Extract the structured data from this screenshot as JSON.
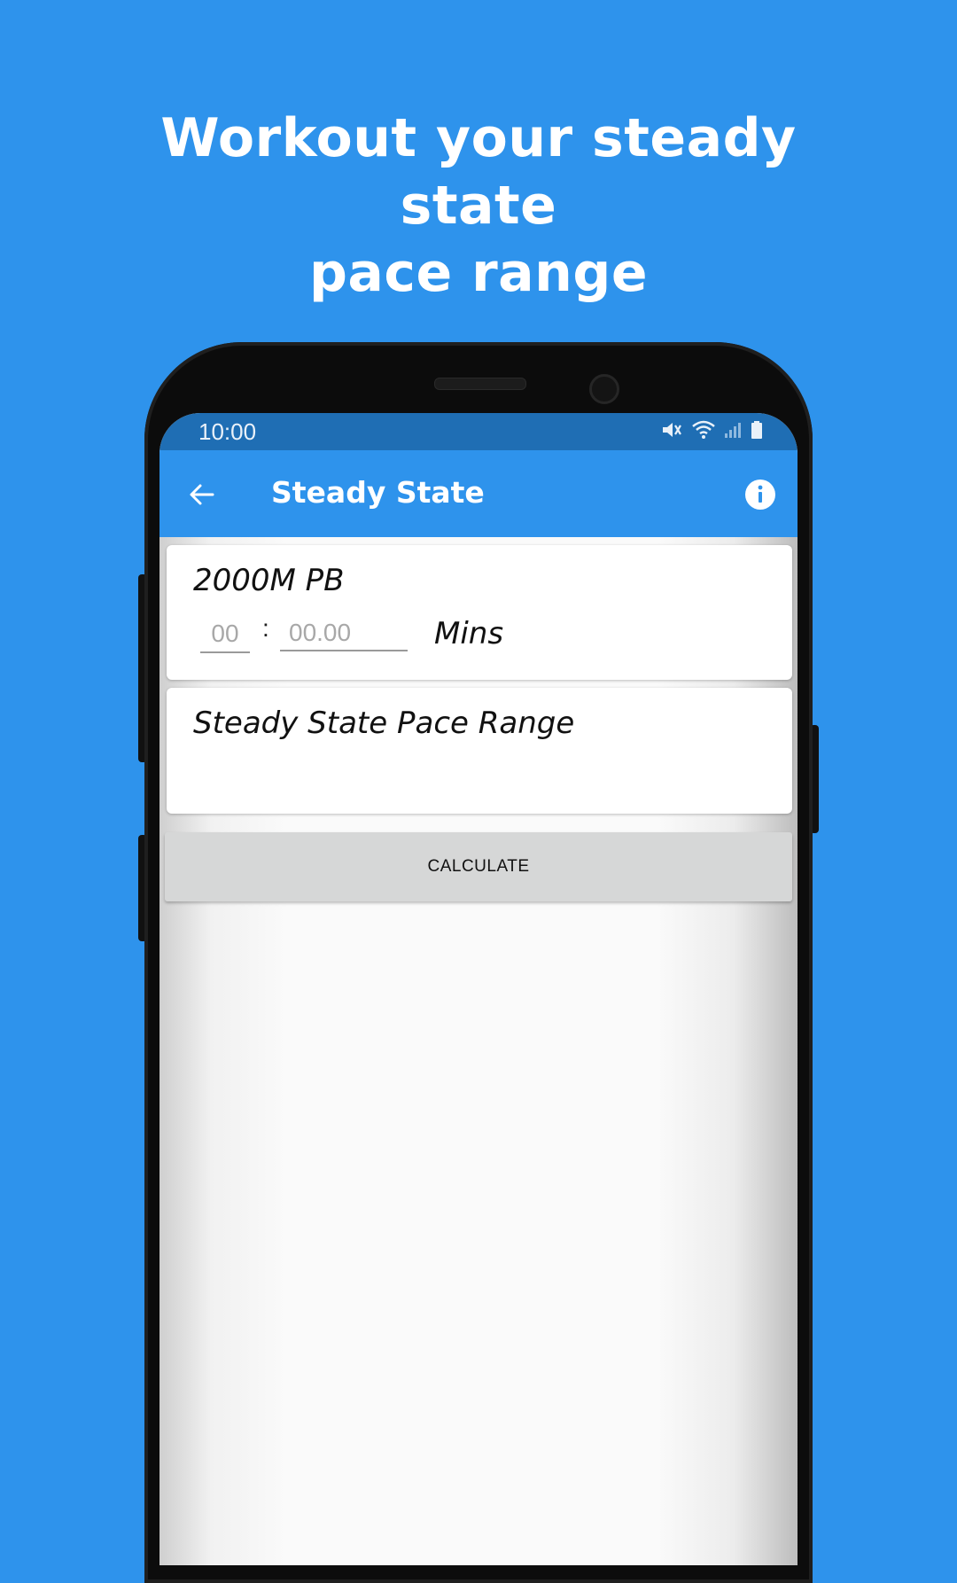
{
  "headline": {
    "line1": "Workout your steady state",
    "line2": "pace range"
  },
  "status_bar": {
    "time": "10:00",
    "icons": [
      "mute-icon",
      "wifi-icon",
      "signal-icon",
      "battery-icon"
    ]
  },
  "app_bar": {
    "title": "Steady State",
    "back_icon": "arrow-left-icon",
    "info_icon": "info-icon"
  },
  "pb_card": {
    "label": "2000M PB",
    "minutes_placeholder": "00",
    "seconds_placeholder": "00.00",
    "separator": ":",
    "units": "Mins"
  },
  "range_card": {
    "label": "Steady State Pace Range"
  },
  "calculate_button": {
    "label": "CALCULATE"
  },
  "colors": {
    "background": "#2e93ec",
    "app_bar": "#2e93ec",
    "status_bar": "#1f6eb4",
    "button": "#d6d7d7"
  }
}
